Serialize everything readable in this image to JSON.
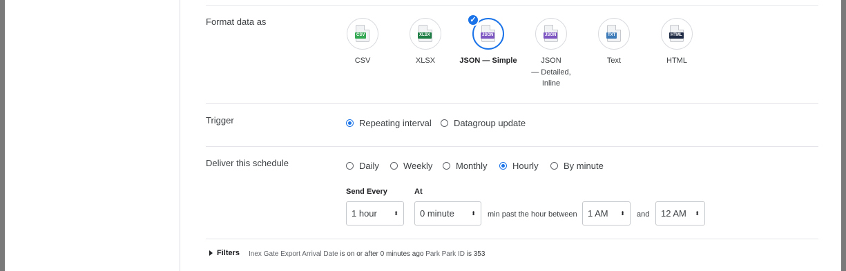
{
  "format": {
    "label": "Format data as",
    "options": [
      {
        "name": "CSV",
        "tag": "CSV",
        "tag_color": "#34a853",
        "selected": false
      },
      {
        "name": "XLSX",
        "tag": "XLSX",
        "tag_color": "#1e7e45",
        "selected": false
      },
      {
        "name": "JSON — Simple",
        "tag": "JSON",
        "tag_color": "#7e57c2",
        "selected": true
      },
      {
        "name_lines": [
          "JSON",
          "— Detailed,",
          "Inline"
        ],
        "tag": "JSON",
        "tag_color": "#7e57c2",
        "selected": false
      },
      {
        "name": "Text",
        "tag": "TXT",
        "tag_color": "#3d7ab8",
        "selected": false
      },
      {
        "name": "HTML",
        "tag": "HTML",
        "tag_color": "#1f2a44",
        "selected": false
      }
    ],
    "check_glyph": "✓"
  },
  "trigger": {
    "label": "Trigger",
    "options": [
      "Repeating interval",
      "Datagroup update"
    ],
    "selected": "Repeating interval"
  },
  "deliver": {
    "label": "Deliver this schedule",
    "options": [
      "Daily",
      "Weekly",
      "Monthly",
      "Hourly",
      "By minute"
    ],
    "selected": "Hourly",
    "send_every_label": "Send Every",
    "at_label": "At",
    "send_every_value": "1 hour",
    "at_value": "0 minute",
    "between_text": "min past the hour between",
    "start_value": "1 AM",
    "and_text": "and",
    "end_value": "12 AM",
    "select_arrow": "⬍"
  },
  "filters": {
    "label": "Filters",
    "field1": "Inex Gate Export Arrival Date",
    "cond1": "is on or after 0 minutes ago",
    "field2": "Park Park ID",
    "cond2": "is 353"
  },
  "colors": {
    "accent": "#1a73e8",
    "sidebar_border": "#dadce0",
    "window_edge": "#7a7a7a"
  }
}
